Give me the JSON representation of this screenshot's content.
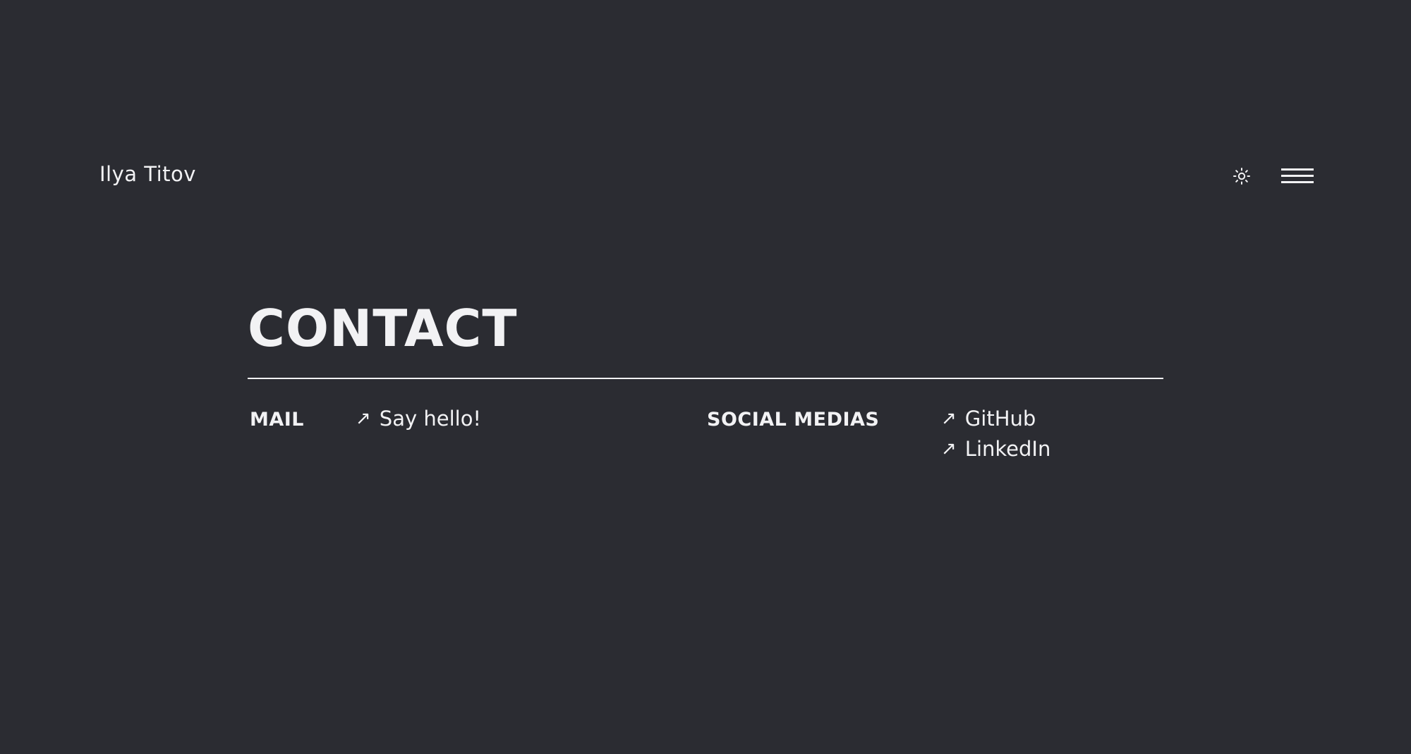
{
  "header": {
    "logo": "Ilya Titov",
    "theme_icon": "sun-icon",
    "menu_icon": "hamburger-menu-icon"
  },
  "contact": {
    "title": "CONTACT",
    "mail_label": "MAIL",
    "mail_link": "Say hello!",
    "social_label": "SOCIAL MEDIAS",
    "social_links": [
      "GitHub",
      "LinkedIn"
    ],
    "arrow_glyph": "↗"
  },
  "colors": {
    "background": "#2b2c32",
    "foreground": "#f2f2f4"
  }
}
